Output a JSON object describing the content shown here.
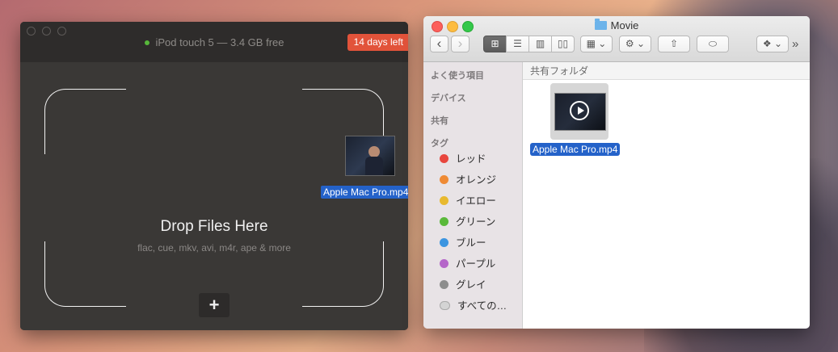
{
  "waltr": {
    "device_status": "iPod touch 5 — 3.4 GB free",
    "trial_badge": "14 days left",
    "drop_title": "Drop Files Here",
    "drop_subtitle": "flac, cue, mkv, avi, m4r, ape & more",
    "add_label": "+",
    "dragged_file": "Apple Mac Pro.mp4",
    "status_color": "#57b83b",
    "badge_color": "#e2533a"
  },
  "finder": {
    "title": "Movie",
    "toolbar": {
      "back": "‹",
      "forward": "›",
      "view_icon": "⊞",
      "view_list": "☰",
      "view_column": "▥",
      "view_coverflow": "▯▯",
      "arrange": "▦ ⌄",
      "action": "⚙ ⌄",
      "share": "⇧",
      "tag": "⬭",
      "dropbox": "❖ ⌄",
      "overflow": "»"
    },
    "sidebar": {
      "favorites": "よく使う項目",
      "devices": "デバイス",
      "shared": "共有",
      "tags_heading": "タグ",
      "tags": [
        {
          "label": "レッド",
          "color": "#e8463e"
        },
        {
          "label": "オレンジ",
          "color": "#ef8a34"
        },
        {
          "label": "イエロー",
          "color": "#e8b92f"
        },
        {
          "label": "グリーン",
          "color": "#5ab93a"
        },
        {
          "label": "ブルー",
          "color": "#3c95e0"
        },
        {
          "label": "パープル",
          "color": "#b566c9"
        },
        {
          "label": "グレイ",
          "color": "#8d8d8d"
        },
        {
          "label": "すべての…",
          "color": "#d4d4d4"
        }
      ]
    },
    "content_header": "共有フォルダ",
    "file_name": "Apple Mac Pro.mp4"
  }
}
